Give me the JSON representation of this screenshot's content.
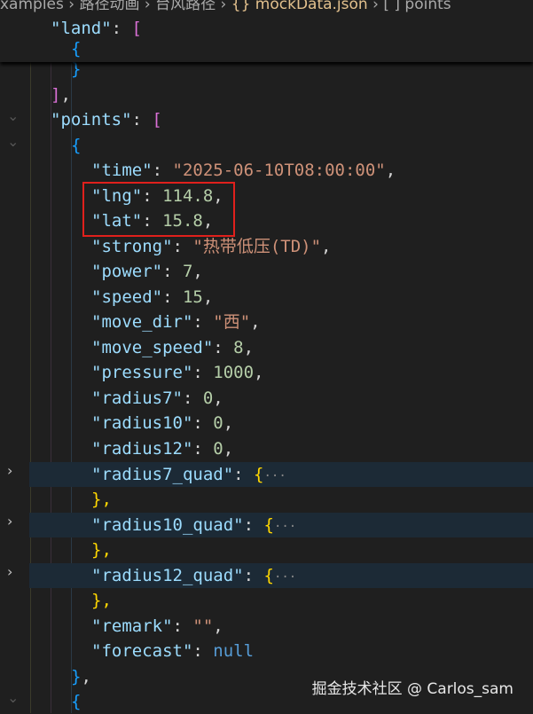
{
  "breadcrumb": [
    "xamples",
    "路径动画",
    "台风路径",
    "{} mockData.json",
    "[ ] points"
  ],
  "sep": "›",
  "watermark": "掘金技术社区 @ Carlos_sam",
  "lines": {
    "land_key": "\"land\"",
    "colon": ": ",
    "open_bracket": "[",
    "open_brace": "{",
    "close_brace": "}",
    "close_bracket_comma": "],",
    "points_key": "\"points\"",
    "time_key": "\"time\"",
    "time_val": "\"2025-06-10T08:00:00\"",
    "lng_key": "\"lng\"",
    "lng_val": "114.8",
    "lat_key": "\"lat\"",
    "lat_val": "15.8",
    "strong_key": "\"strong\"",
    "strong_val": "\"热带低压(TD)\"",
    "power_key": "\"power\"",
    "power_val": "7",
    "speed_key": "\"speed\"",
    "speed_val": "15",
    "move_dir_key": "\"move_dir\"",
    "move_dir_val": "\"西\"",
    "move_speed_key": "\"move_speed\"",
    "move_speed_val": "8",
    "pressure_key": "\"pressure\"",
    "pressure_val": "1000",
    "radius7_key": "\"radius7\"",
    "radius7_val": "0",
    "radius10_key": "\"radius10\"",
    "radius10_val": "0",
    "radius12_key": "\"radius12\"",
    "radius12_val": "0",
    "radius7_quad_key": "\"radius7_quad\"",
    "radius10_quad_key": "\"radius10_quad\"",
    "radius12_quad_key": "\"radius12_quad\"",
    "ellipsis": "···",
    "brace_comma": "},",
    "comma": ",",
    "remark_key": "\"remark\"",
    "remark_val": "\"\"",
    "forecast_key": "\"forecast\"",
    "forecast_val": "null"
  }
}
